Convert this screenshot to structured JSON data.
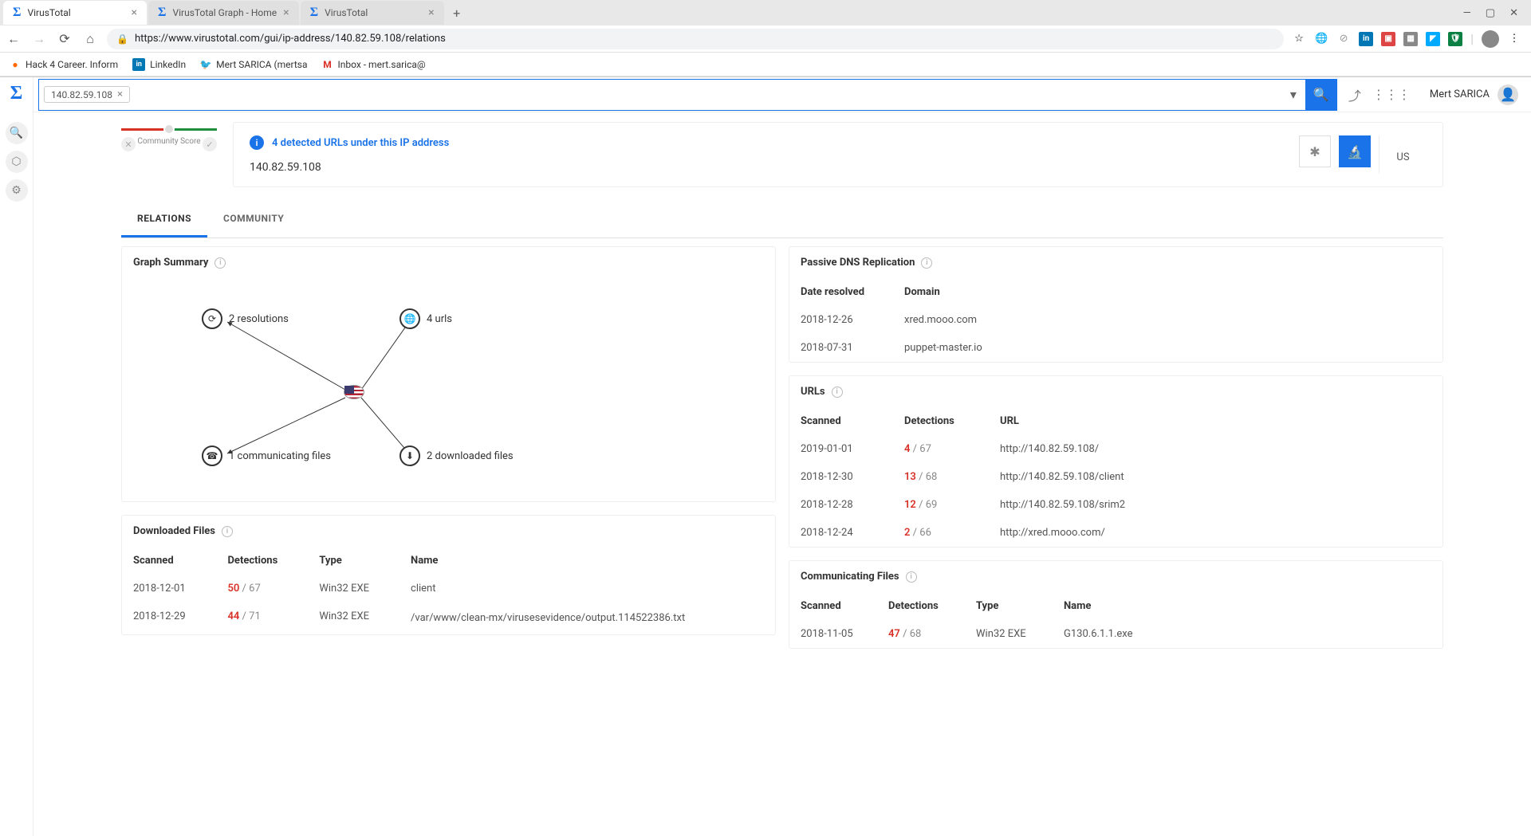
{
  "browser": {
    "tabs": [
      {
        "title": "VirusTotal",
        "active": true
      },
      {
        "title": "VirusTotal Graph - Home",
        "active": false
      },
      {
        "title": "VirusTotal",
        "active": false
      }
    ],
    "url": "https://www.virustotal.com/gui/ip-address/140.82.59.108/relations",
    "bookmarks": [
      {
        "label": "Hack 4 Career. Inform",
        "icon": "🟠"
      },
      {
        "label": "LinkedIn",
        "icon": "in"
      },
      {
        "label": "Mert SARICA (mertsa",
        "icon": "🐦"
      },
      {
        "label": "Inbox - mert.sarica@",
        "icon": "M"
      }
    ]
  },
  "vt": {
    "search_chip": "140.82.59.108",
    "user_name": "Mert SARICA",
    "alert_text": "4 detected URLs under this IP address",
    "ip": "140.82.59.108",
    "country": "US",
    "community_label": "Community Score",
    "tabs": {
      "relations": "RELATIONS",
      "community": "COMMUNITY"
    },
    "graph_summary": {
      "title": "Graph Summary",
      "nodes": {
        "resolutions": "2 resolutions",
        "urls": "4 urls",
        "comm_files": "1 communicating files",
        "dl_files": "2 downloaded files"
      }
    },
    "downloaded_files": {
      "title": "Downloaded Files",
      "headers": {
        "scanned": "Scanned",
        "detections": "Detections",
        "type": "Type",
        "name": "Name"
      },
      "rows": [
        {
          "scanned": "2018-12-01",
          "det_n": "50",
          "det_t": "67",
          "type": "Win32 EXE",
          "name": "client"
        },
        {
          "scanned": "2018-12-29",
          "det_n": "44",
          "det_t": "71",
          "type": "Win32 EXE",
          "name": "/var/www/clean-mx/virusesevidence/output.114522386.txt"
        }
      ]
    },
    "passive_dns": {
      "title": "Passive DNS Replication",
      "headers": {
        "date": "Date resolved",
        "domain": "Domain"
      },
      "rows": [
        {
          "date": "2018-12-26",
          "domain": "xred.mooo.com"
        },
        {
          "date": "2018-07-31",
          "domain": "puppet-master.io"
        }
      ]
    },
    "urls": {
      "title": "URLs",
      "headers": {
        "scanned": "Scanned",
        "detections": "Detections",
        "url": "URL"
      },
      "rows": [
        {
          "scanned": "2019-01-01",
          "det_n": "4",
          "det_t": "67",
          "url": "http://140.82.59.108/"
        },
        {
          "scanned": "2018-12-30",
          "det_n": "13",
          "det_t": "68",
          "url": "http://140.82.59.108/client"
        },
        {
          "scanned": "2018-12-28",
          "det_n": "12",
          "det_t": "69",
          "url": "http://140.82.59.108/srim2"
        },
        {
          "scanned": "2018-12-24",
          "det_n": "2",
          "det_t": "66",
          "url": "http://xred.mooo.com/"
        }
      ]
    },
    "comm_files": {
      "title": "Communicating Files",
      "headers": {
        "scanned": "Scanned",
        "detections": "Detections",
        "type": "Type",
        "name": "Name"
      },
      "rows": [
        {
          "scanned": "2018-11-05",
          "det_n": "47",
          "det_t": "68",
          "type": "Win32 EXE",
          "name": "G130.6.1.1.exe"
        }
      ]
    }
  }
}
